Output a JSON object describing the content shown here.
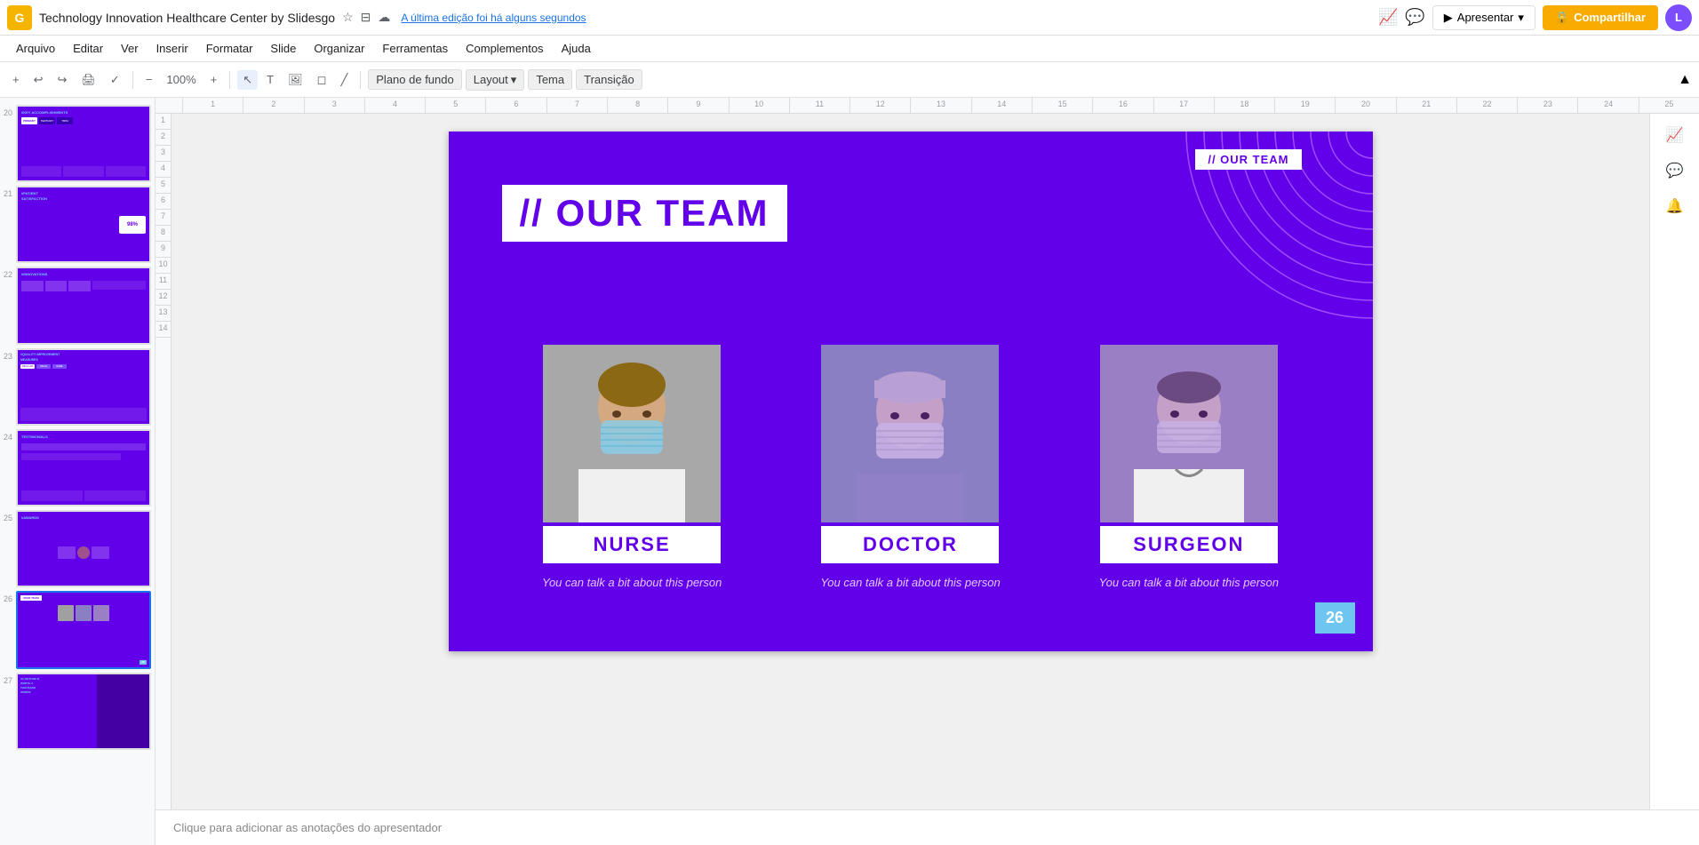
{
  "app": {
    "logo": "G",
    "doc_title": "Technology Innovation Healthcare Center by Slidesgo",
    "autosave_text": "A última edição foi há alguns segundos"
  },
  "top_bar": {
    "present_label": "Apresentar",
    "share_label": "Compartilhar",
    "avatar_initials": "L"
  },
  "menu": {
    "items": [
      "Arquivo",
      "Editar",
      "Ver",
      "Inserir",
      "Formatar",
      "Slide",
      "Organizar",
      "Ferramentas",
      "Complementos",
      "Ajuda"
    ]
  },
  "toolbar": {
    "zoom_label": "Plano de fundo",
    "layout_label": "Layout",
    "theme_label": "Tema",
    "transition_label": "Transição"
  },
  "slide": {
    "background_color": "#6200ea",
    "top_label": "// OUR TEAM",
    "title_prefix": "//",
    "title_main": " OUR TEAM",
    "page_number": "26",
    "decorative_accent_color": "#9c4dff",
    "members": [
      {
        "role": "NURSE",
        "description": "You can talk a bit\nabout this person",
        "photo_color": "#a0a0a0"
      },
      {
        "role": "DOCTOR",
        "description": "You can talk a bit\nabout this person",
        "photo_color": "#8b7fc4"
      },
      {
        "role": "SURGEON",
        "description": "You can talk a bit\nabout this person",
        "photo_color": "#9b7fc4"
      }
    ]
  },
  "sidebar": {
    "slides": [
      {
        "num": "20",
        "type": "accomplishments"
      },
      {
        "num": "21",
        "type": "satisfaction"
      },
      {
        "num": "22",
        "type": "innovations"
      },
      {
        "num": "23",
        "type": "quality"
      },
      {
        "num": "24",
        "type": "testimonials"
      },
      {
        "num": "25",
        "type": "awards"
      },
      {
        "num": "26",
        "type": "team",
        "active": true
      },
      {
        "num": "27",
        "type": "picture"
      }
    ]
  },
  "bottom_bar": {
    "notes_placeholder": "Clique para adicionar as anotações do apresentador"
  },
  "right_panel": {
    "icons": [
      "📈",
      "💬",
      "🔔"
    ]
  }
}
